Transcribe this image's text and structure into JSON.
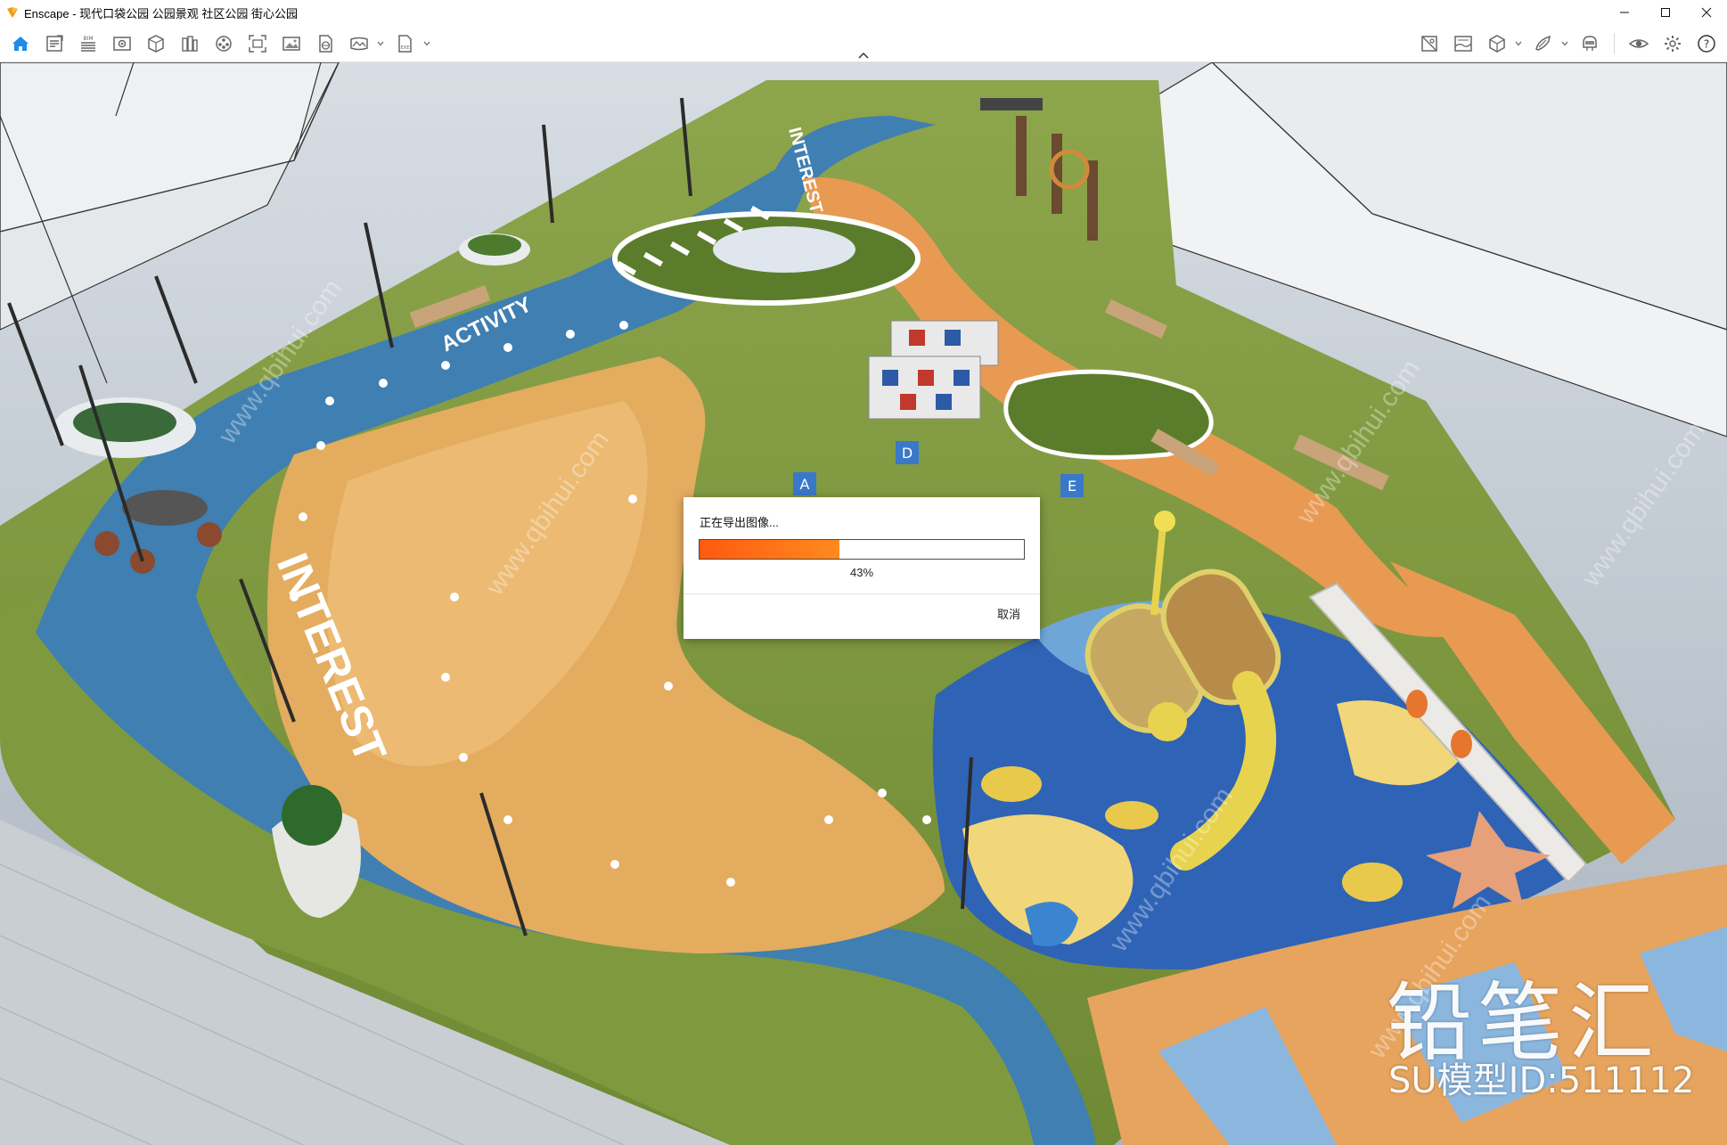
{
  "window": {
    "title": "Enscape - 现代口袋公园 公园景观 社区公园 街心公园"
  },
  "toolbar": {
    "left_icons": [
      "home-icon",
      "notes-icon",
      "bim-icon",
      "views-icon",
      "asset-library-icon",
      "materials-icon",
      "video-editor-icon",
      "screenshot-icon",
      "batch-render-icon",
      "web-standalone-icon",
      "panorama-icon",
      "export-icon"
    ],
    "right_icons": [
      "atmosphere-icon",
      "sky-icon",
      "cube-icon",
      "sketch-icon",
      "vr-headset-icon",
      "visual-settings-icon",
      "settings-icon",
      "help-icon"
    ],
    "accent_color": "#1e8be6"
  },
  "scene": {
    "labels": {
      "interest_large": "INTEREST",
      "interest_small": "INTEREST",
      "activity": "ACTIVITY"
    },
    "block_letters": [
      "A",
      "D",
      "E"
    ],
    "watermark": {
      "repeat_text": "www.qbihui.com",
      "brand": "铅笔汇",
      "model_id": "SU模型ID:511112"
    }
  },
  "dialog": {
    "title": "正在导出图像...",
    "progress_percent": 43,
    "progress_label": "43%",
    "cancel_label": "取消",
    "progress_color": "#ff6a16"
  }
}
